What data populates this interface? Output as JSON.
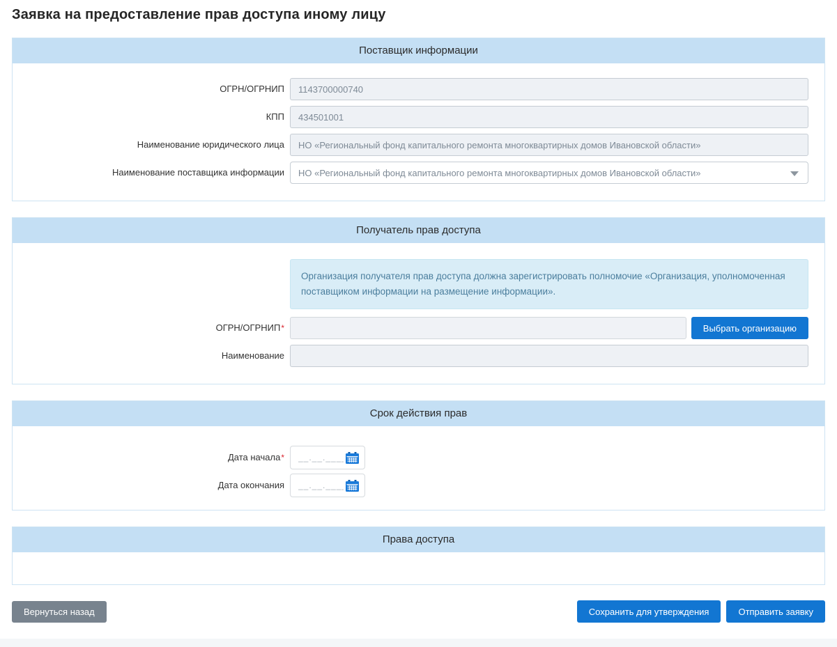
{
  "page": {
    "title": "Заявка на предоставление прав доступа иному лицу"
  },
  "colors": {
    "section_header_bg": "#c4dff4",
    "section_border": "#cde3f3",
    "primary_button": "#1276d2",
    "secondary_button": "#78838e",
    "info_box_bg": "#d9edf7",
    "info_box_text": "#4b7e9d",
    "required_asterisk": "#d9232d",
    "calendar_icon": "#1a7ad9"
  },
  "icons": {
    "dropdown": "caret-down-icon",
    "calendar": "calendar-icon"
  },
  "sections": {
    "provider": {
      "title": "Поставщик информации",
      "fields": {
        "ogrn": {
          "label": "ОГРН/ОГРНИП",
          "value": "1143700000740"
        },
        "kpp": {
          "label": "КПП",
          "value": "434501001"
        },
        "legal_name": {
          "label": "Наименование юридического лица",
          "value": "НО «Региональный фонд капитального ремонта многоквартирных домов Ивановской области»"
        },
        "provider_name": {
          "label": "Наименование поставщика информации",
          "value": "НО «Региональный фонд капитального ремонта многоквартирных домов Ивановской области»"
        }
      }
    },
    "recipient": {
      "title": "Получатель прав доступа",
      "info_text": "Организация получателя прав доступа должна зарегистрировать полномочие «Организация, уполномоченная поставщиком информации на размещение информации».",
      "fields": {
        "ogrn": {
          "label": "ОГРН/ОГРНИП",
          "required": "*",
          "value": ""
        },
        "name": {
          "label": "Наименование",
          "value": ""
        }
      },
      "select_org_button": "Выбрать организацию"
    },
    "validity": {
      "title": "Срок действия прав",
      "fields": {
        "start_date": {
          "label": "Дата начала",
          "required": "*",
          "placeholder": "__.__.____",
          "value": ""
        },
        "end_date": {
          "label": "Дата окончания",
          "placeholder": "__.__.____",
          "value": ""
        }
      }
    },
    "rights": {
      "title": "Права доступа"
    }
  },
  "footer": {
    "back_button": "Вернуться назад",
    "save_button": "Сохранить для утверждения",
    "submit_button": "Отправить заявку"
  }
}
